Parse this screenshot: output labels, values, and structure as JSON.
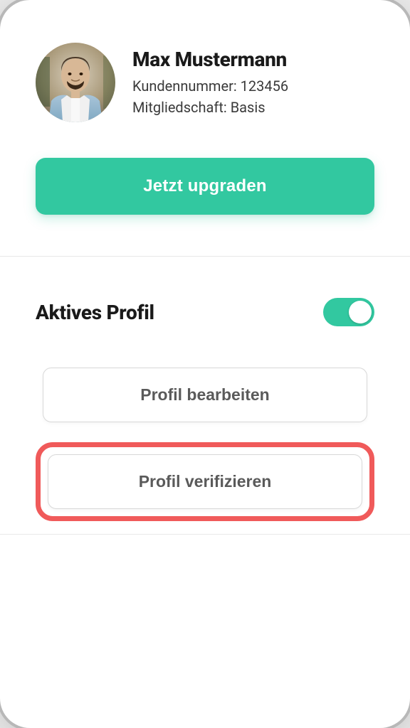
{
  "profile": {
    "name": "Max Mustermann",
    "customer_label": "Kundennummer:",
    "customer_value": "123456",
    "membership_label": "Mitgliedschaft:",
    "membership_value": "Basis"
  },
  "upgrade": {
    "label": "Jetzt upgraden"
  },
  "section": {
    "title": "Aktives Profil",
    "toggle_on": true
  },
  "actions": {
    "edit_label": "Profil bearbeiten",
    "verify_label": "Profil verifizieren"
  },
  "colors": {
    "accent": "#32c8a0",
    "highlight": "#f05a5a"
  }
}
